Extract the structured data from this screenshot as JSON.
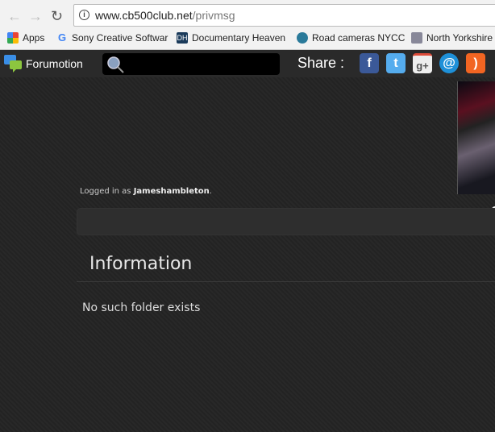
{
  "browser": {
    "url_host": "www.cb500club.net",
    "url_path": "/privmsg",
    "bookmarks": [
      {
        "label": "Apps",
        "icon": "apps-grid-icon"
      },
      {
        "label": "Sony Creative Softwar",
        "icon": "google-icon"
      },
      {
        "label": "Documentary Heaven",
        "icon": "dh-icon"
      },
      {
        "label": "Road cameras NYCC",
        "icon": "nycc-icon"
      },
      {
        "label": "North Yorkshire",
        "icon": "police-icon"
      }
    ]
  },
  "topbar": {
    "brand": "Forumotion",
    "share_label": "Share :",
    "social": [
      "facebook",
      "twitter",
      "google-plus",
      "email",
      "rss"
    ],
    "social_colors": [
      "#3b5998",
      "#55acee",
      "#dd4b39",
      "#1e90d8",
      "#f26522"
    ]
  },
  "main": {
    "logged_prefix": "Logged in as ",
    "username": "Jameshambleton",
    "logged_suffix": ".",
    "title": "Information",
    "message": "No such folder exists"
  }
}
